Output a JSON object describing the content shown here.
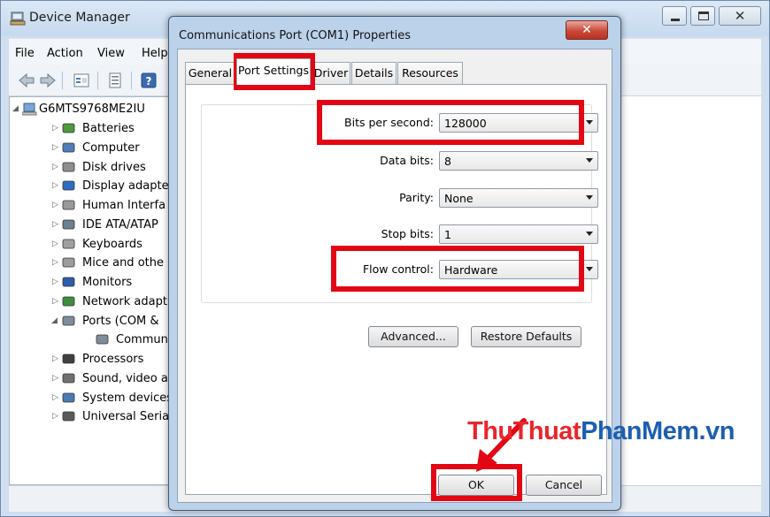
{
  "device_manager": {
    "title": "Device Manager",
    "menu": [
      "File",
      "Action",
      "View",
      "Help"
    ],
    "computer_name": "G6MTS9768ME2IU",
    "tree_items": [
      {
        "label": "Batteries",
        "icon": "battery-icon"
      },
      {
        "label": "Computer",
        "icon": "computer-icon"
      },
      {
        "label": "Disk drives",
        "icon": "disk-drive-icon"
      },
      {
        "label": "Display adapte",
        "icon": "display-adapter-icon"
      },
      {
        "label": "Human Interfa",
        "icon": "hid-icon"
      },
      {
        "label": "IDE ATA/ATAP",
        "icon": "ide-icon"
      },
      {
        "label": "Keyboards",
        "icon": "keyboard-icon"
      },
      {
        "label": "Mice and othe",
        "icon": "mouse-icon"
      },
      {
        "label": "Monitors",
        "icon": "monitor-icon"
      },
      {
        "label": "Network adapt",
        "icon": "network-adapter-icon"
      },
      {
        "label": "Ports (COM &",
        "icon": "port-icon"
      },
      {
        "label": "Communic",
        "icon": "port-icon"
      },
      {
        "label": "Processors",
        "icon": "processor-icon"
      },
      {
        "label": "Sound, video a",
        "icon": "sound-icon"
      },
      {
        "label": "System devices",
        "icon": "system-device-icon"
      },
      {
        "label": "Universal Serial",
        "icon": "usb-icon"
      }
    ]
  },
  "dialog": {
    "title": "Communications Port (COM1) Properties",
    "close_glyph": "✕",
    "tabs": [
      "General",
      "Port Settings",
      "Driver",
      "Details",
      "Resources"
    ],
    "active_tab": "Port Settings",
    "fields": {
      "bits_per_second": {
        "label": "Bits per second:",
        "value": "128000"
      },
      "data_bits": {
        "label": "Data bits:",
        "value": "8"
      },
      "parity": {
        "label": "Parity:",
        "value": "None"
      },
      "stop_bits": {
        "label": "Stop bits:",
        "value": "1"
      },
      "flow_control": {
        "label": "Flow control:",
        "value": "Hardware"
      }
    },
    "advanced_label": "Advanced...",
    "restore_label": "Restore Defaults",
    "ok_label": "OK",
    "cancel_label": "Cancel"
  },
  "watermark": {
    "part1": "ThuThuat",
    "part2": "PhanMem.vn"
  },
  "colors": {
    "highlight": "#e30613",
    "watermark_red": "#e8262c",
    "watermark_blue": "#1c5fb0"
  }
}
